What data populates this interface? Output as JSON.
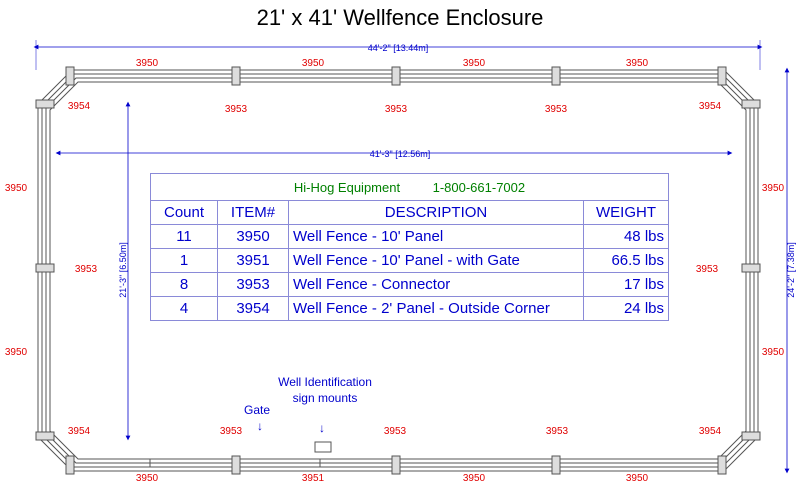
{
  "title": "21' x 41' Wellfence Enclosure",
  "dimensions": {
    "overall_width": "44'-2\" [13.44m]",
    "inner_width": "41'-3\" [12.56m]",
    "inner_height": "21'-3\" [6.50m]",
    "overall_height": "24'-2\" [7.38m]"
  },
  "part_labels": {
    "top_panels": [
      "3950",
      "3950",
      "3950",
      "3950"
    ],
    "top_connectors": [
      "3953",
      "3953",
      "3953"
    ],
    "corners_top": [
      "3954",
      "3954"
    ],
    "left_panels": [
      "3950",
      "3950"
    ],
    "left_connector": "3953",
    "right_panels": [
      "3950",
      "3950"
    ],
    "right_connector": "3953",
    "corners_bottom": [
      "3954",
      "3954"
    ],
    "bottom_connectors": [
      "3953",
      "3953",
      "3953"
    ],
    "bottom_panels": [
      "3950",
      "3951",
      "3950",
      "3950"
    ],
    "gate_panel_left": "3950"
  },
  "notes": {
    "gate": "Gate",
    "sign_line1": "Well Identification",
    "sign_line2": "sign mounts"
  },
  "table": {
    "company": "Hi-Hog Equipment",
    "phone": "1-800-661-7002",
    "headers": [
      "Count",
      "ITEM#",
      "DESCRIPTION",
      "WEIGHT"
    ],
    "rows": [
      {
        "count": "11",
        "item": "3950",
        "description": "Well Fence - 10' Panel",
        "weight": "48 lbs"
      },
      {
        "count": "1",
        "item": "3951",
        "description": "Well Fence - 10' Panel - with Gate",
        "weight": "66.5 lbs"
      },
      {
        "count": "8",
        "item": "3953",
        "description": "Well Fence - Connector",
        "weight": "17 lbs"
      },
      {
        "count": "4",
        "item": "3954",
        "description": "Well Fence - 2' Panel - Outside Corner",
        "weight": "24 lbs"
      }
    ]
  },
  "colors": {
    "part_label": "#e00000",
    "dimension": "#0000cc",
    "company": "#008000",
    "fence": "#555555"
  }
}
